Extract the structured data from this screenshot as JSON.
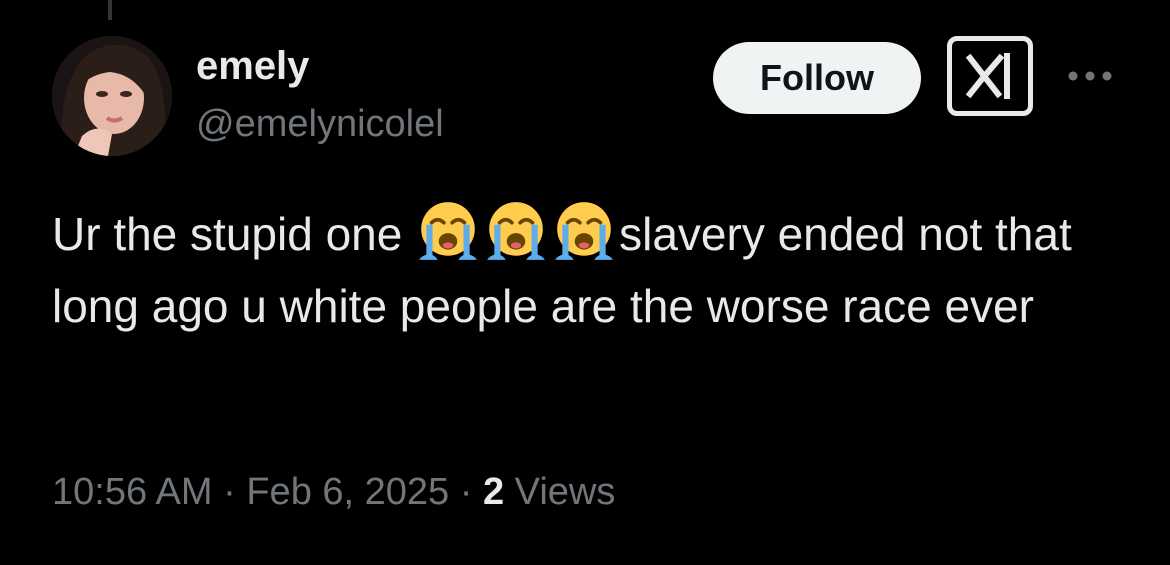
{
  "author": {
    "display_name": "emely",
    "handle": "@emelynicolel"
  },
  "actions": {
    "follow_label": "Follow",
    "grok_icon": "grok-icon",
    "more_icon": "more-icon"
  },
  "tweet": {
    "text_part1": "Ur the stupid one ",
    "emoji_name": "loudly-crying-face",
    "emoji_count": 3,
    "text_part2": "slavery ended not that long ago u white people are the worse race ever"
  },
  "meta": {
    "time": "10:56 AM",
    "separator": "·",
    "date": "Feb 6, 2025",
    "views_count": "2",
    "views_label": "Views"
  },
  "colors": {
    "background": "#000000",
    "text_primary": "#e7e9ea",
    "text_secondary": "#71767b",
    "follow_bg": "#eff3f4",
    "follow_text": "#0f1419"
  }
}
